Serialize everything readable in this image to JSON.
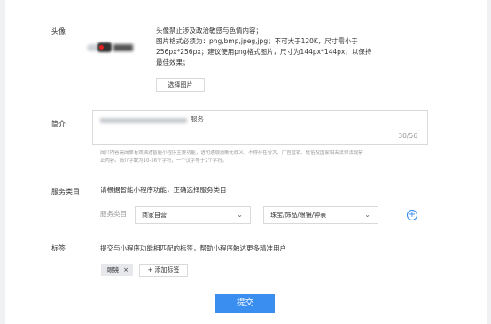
{
  "avatar": {
    "label": "头像",
    "rules": [
      "头像禁止涉及政治敏感与色情内容；",
      "图片格式必须为：png,bmp,jpeg,jpg；不可大于120K，尺寸需小于",
      "256px*256px；建议使用png格式图片，尺寸为144px*144px，以保持",
      "最佳效果；"
    ],
    "choose_button": "选择图片"
  },
  "intro": {
    "label": "简介",
    "value_suffix": "服务",
    "counter": "30/56",
    "hint_lines": [
      "简介内容需简单有效描述智能小程序主要功能，语句通顺清晰无歧义，不得存在夸大、广告营销、低俗及国家相关法律法规禁",
      "止内容。简介字数为10-56个字符，一个汉字等于2个字符。"
    ]
  },
  "service": {
    "label": "服务类目",
    "instruction": "请根据智能小程序功能，正确选择服务类目",
    "sub_label": "服务类目",
    "category_1": "商家自营",
    "category_2": "珠宝/饰品/眼镜/钟表"
  },
  "tags": {
    "label": "标签",
    "instruction": "提交与小程序功能相匹配的标签，帮助小程序触达更多精准用户",
    "items": [
      "眼镜"
    ],
    "add_button": "+ 添加标签"
  },
  "submit_label": "提交",
  "colors": {
    "accent": "#3a8ef0"
  },
  "icons": {
    "remove": "close-icon",
    "add": "plus-circle-icon",
    "dropdown": "chevron-down-icon"
  }
}
